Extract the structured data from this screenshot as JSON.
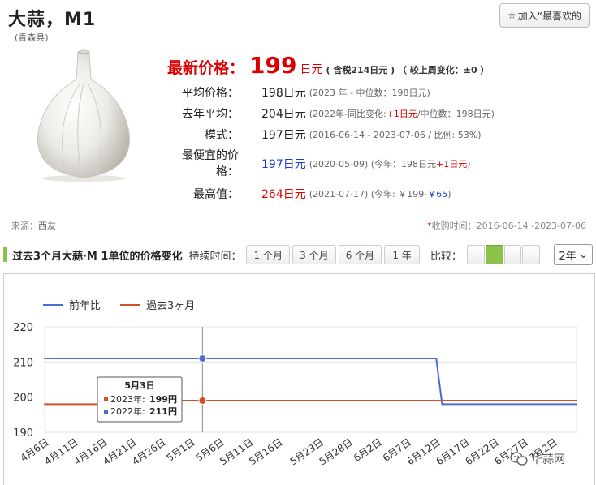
{
  "header": {
    "title": "大蒜，M1",
    "subtitle": "(青森县)",
    "fav_label": "加入“最喜欢的"
  },
  "price": {
    "latest_label": "最新价格：",
    "latest_value": "199",
    "latest_unit": "日元",
    "latest_note": "( 含税214日元 ) （ 较上周变化：±0 ）",
    "rows": [
      {
        "label": "平均价格：",
        "value": "198日元",
        "detail": "(2023 年 - 中位数：198日元)"
      },
      {
        "label": "去年平均：",
        "value": "204日元",
        "detail_a": "(2022年-同比变化:",
        "detail_red": "+1日元",
        "detail_b": "/中位数：198日元)"
      },
      {
        "label": "模式：",
        "value": "197日元",
        "detail": "(2016-06-14 - 2023-07-06 / 比例: 53%)"
      },
      {
        "label": "最便宜的价格：",
        "value": "197日元",
        "detail_a": "(2020-05-09) (今年：198日元",
        "detail_red": "+1日元",
        "detail_b": ")"
      },
      {
        "label": "最高值：",
        "value": "264日元",
        "detail_a": "(2021-07-17) (今年: ￥199-",
        "detail_blue": "￥65",
        "detail_b": ")"
      }
    ]
  },
  "source": {
    "label": "来源：",
    "link": "西友"
  },
  "collect": {
    "star": "*",
    "text": "收购时间：2016-06-14 -2023-07-06"
  },
  "toolbar": {
    "title": "过去3个月大蒜·M 1单位的价格变化",
    "duration_label": "持续时间：",
    "durations": [
      "1 个月",
      "3 个月",
      "6 个月",
      "1 年"
    ],
    "compare_label": "比较：",
    "year_select": "2年"
  },
  "colors": {
    "prev_year": "#4a6fd0",
    "past3m": "#d0502a",
    "accent": "#8bc34a"
  },
  "chart_data": {
    "type": "line",
    "legend_position": "top-left",
    "series": [
      {
        "name": "前年比",
        "color": "#4a6fd0",
        "points": [
          [
            "4月6日",
            211
          ],
          [
            "5月3日",
            211
          ],
          [
            "6月12日",
            211
          ],
          [
            "6月13日",
            198
          ],
          [
            "7月6日",
            198
          ]
        ]
      },
      {
        "name": "過去3ヶ月",
        "color": "#d0502a",
        "points": [
          [
            "4月6日",
            198
          ],
          [
            "4月26日",
            198
          ],
          [
            "4月27日",
            199
          ],
          [
            "7月6日",
            199
          ]
        ]
      }
    ],
    "x_ticks": [
      "4月6日",
      "4月11日",
      "4月16日",
      "4月21日",
      "4月26日",
      "5月1日",
      "5月6日",
      "5月11日",
      "5月16日",
      "5月23日",
      "5月28日",
      "6月2日",
      "6月7日",
      "6月12日",
      "6月17日",
      "6月22日",
      "6月27日",
      "7月2日"
    ],
    "y_ticks": [
      190,
      200,
      210,
      220
    ],
    "ylim": [
      190,
      220
    ],
    "grid": true,
    "tooltip": {
      "date": "5月3日",
      "rows": [
        {
          "label": "2023年: ",
          "value": "199円",
          "color": "#d0502a"
        },
        {
          "label": "2022年: ",
          "value": "211円",
          "color": "#4a6fd0"
        }
      ]
    }
  },
  "watermark": "华蒜网"
}
